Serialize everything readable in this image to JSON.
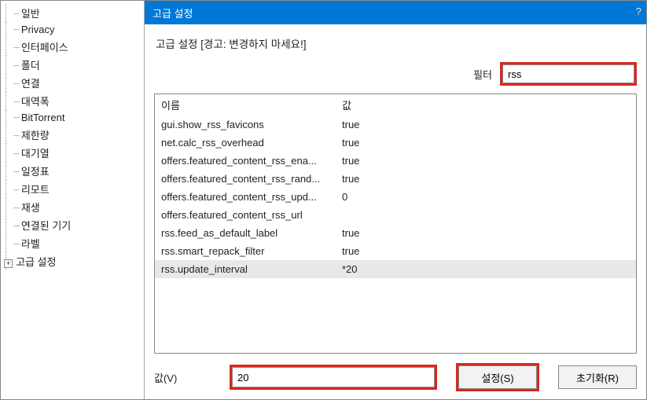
{
  "sidebar": {
    "items": [
      {
        "label": "일반"
      },
      {
        "label": "Privacy"
      },
      {
        "label": "인터페이스"
      },
      {
        "label": "폴더"
      },
      {
        "label": "연결"
      },
      {
        "label": "대역폭"
      },
      {
        "label": "BitTorrent"
      },
      {
        "label": "제한량"
      },
      {
        "label": "대기열"
      },
      {
        "label": "일정표"
      },
      {
        "label": "리모트"
      },
      {
        "label": "재생"
      },
      {
        "label": "연결된 기기"
      },
      {
        "label": "라벨"
      }
    ],
    "advanced": {
      "label": "고급 설정",
      "expander": "+"
    }
  },
  "titlebar": {
    "title": "고급 설정",
    "help": "?"
  },
  "warning": "고급 설정 [경고: 변경하지 마세요!]",
  "filter": {
    "label": "필터",
    "value": "rss"
  },
  "columns": {
    "name": "이름",
    "value": "값"
  },
  "rows": [
    {
      "name": "gui.show_rss_favicons",
      "value": "true"
    },
    {
      "name": "net.calc_rss_overhead",
      "value": "true"
    },
    {
      "name": "offers.featured_content_rss_ena...",
      "value": "true"
    },
    {
      "name": "offers.featured_content_rss_rand...",
      "value": "true"
    },
    {
      "name": "offers.featured_content_rss_upd...",
      "value": "0"
    },
    {
      "name": "offers.featured_content_rss_url",
      "value": ""
    },
    {
      "name": "rss.feed_as_default_label",
      "value": "true"
    },
    {
      "name": "rss.smart_repack_filter",
      "value": "true"
    },
    {
      "name": "rss.update_interval",
      "value": "*20",
      "selected": true
    }
  ],
  "bottom": {
    "value_label": "값(V)",
    "value": "20",
    "set_btn": "설정(S)",
    "reset_btn": "초기화(R)"
  }
}
